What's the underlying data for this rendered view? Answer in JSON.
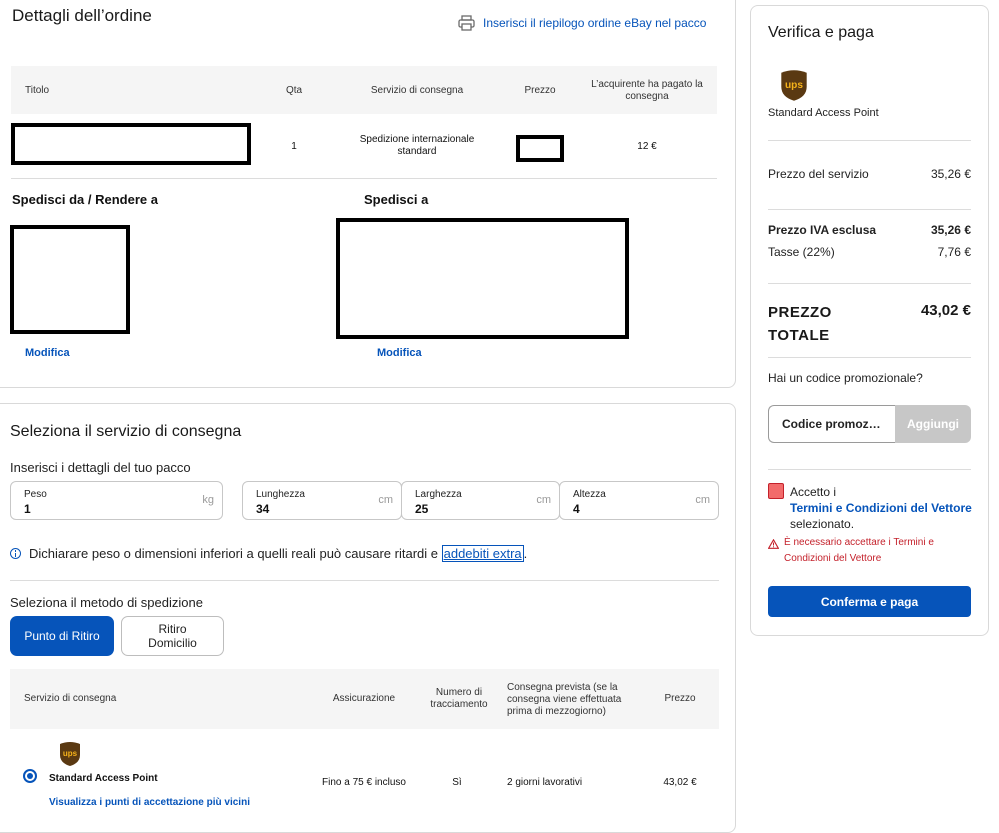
{
  "order": {
    "title": "Dettagli dell’ordine",
    "print_link": "Inserisci il riepilogo ordine eBay nel pacco",
    "table_headers": {
      "title": "Titolo",
      "qty": "Qta",
      "service": "Servizio di consegna",
      "price": "Prezzo",
      "buyer_paid": "L’acquirente ha pagato la consegna"
    },
    "row": {
      "qty": "1",
      "service": "Spedizione internazionale standard",
      "buyer_paid": "12 €"
    },
    "ship_from_heading": "Spedisci da / Rendere a",
    "ship_to_heading": "Spedisci a",
    "modify_from": "Modifica",
    "modify_to": "Modifica"
  },
  "delivery": {
    "title": "Seleziona il servizio di consegna",
    "package_heading": "Inserisci i dettagli del tuo pacco",
    "fields": [
      {
        "label": "Peso",
        "value": "1",
        "unit": "kg"
      },
      {
        "label": "Lunghezza",
        "value": "34",
        "unit": "cm"
      },
      {
        "label": "Larghezza",
        "value": "25",
        "unit": "cm"
      },
      {
        "label": "Altezza",
        "value": "4",
        "unit": "cm"
      }
    ],
    "warning_text": "Dichiarare peso o dimensioni inferiori a quelli reali può causare ritardi e ",
    "warning_link": "addebiti extra",
    "warning_end": ".",
    "method_heading": "Seleziona il metodo di spedizione",
    "method_pickup": "Punto di Ritiro",
    "method_home": "Ritiro Domicilio",
    "headers": {
      "service": "Servizio di consegna",
      "insurance": "Assicurazione",
      "tracking": "Numero di tracciamento",
      "expected": "Consegna prevista (se la consegna viene effettuata prima di mezzogiorno)",
      "price": "Prezzo"
    },
    "option": {
      "carrier_logo": "ups",
      "name": "Standard Access Point",
      "link": "Visualizza i punti di accettazione più vicini",
      "insurance": "Fino a 75 € incluso",
      "tracking": "Sì",
      "expected": "2 giorni lavorativi",
      "price": "43,02 €"
    }
  },
  "summary": {
    "title": "Verifica e paga",
    "carrier_logo": "ups",
    "service_name": "Standard Access Point",
    "service_price_label": "Prezzo del servizio",
    "service_price_value": "35,26 €",
    "ex_vat_label": "Prezzo IVA esclusa",
    "ex_vat_value": "35,26 €",
    "tax_label": "Tasse (22%)",
    "tax_value": "7,76 €",
    "total_label": "PREZZO TOTALE",
    "total_value": "43,02 €",
    "promo_question": "Hai un codice promozionale?",
    "promo_placeholder": "Codice promoz…",
    "promo_button": "Aggiungi",
    "accept_prefix": "Accetto i",
    "accept_link": "Termini e Condizioni del Vettore",
    "accept_suffix": "selezionato.",
    "error_text": "È necessario accettare i Termini e Condizioni del Vettore",
    "confirm_button": "Conferma e paga"
  },
  "colors": {
    "accent": "#0654ba",
    "primary_button": "#0654ba",
    "error": "#c4212b",
    "checkbox_error_fill": "#f26b6b",
    "ups_brown": "#5a3912",
    "ups_gold": "#f5b21a"
  }
}
